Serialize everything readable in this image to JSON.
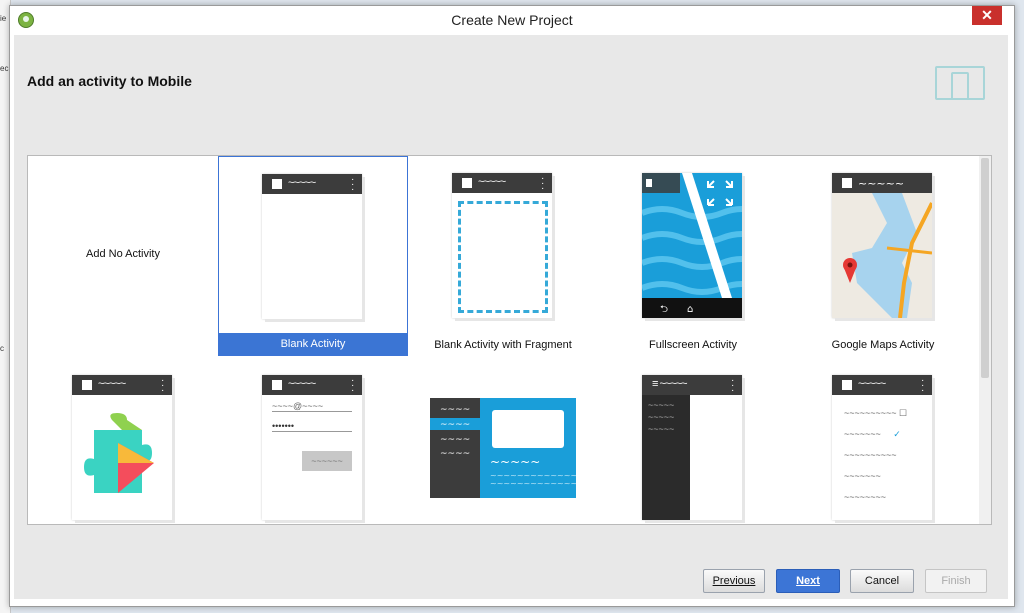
{
  "window": {
    "title": "Create New Project",
    "close_label": "✕"
  },
  "header": {
    "heading": "Add an activity to Mobile"
  },
  "gallery": {
    "items": [
      {
        "label": "Add No Activity"
      },
      {
        "label": "Blank Activity",
        "selected": true
      },
      {
        "label": "Blank Activity with Fragment"
      },
      {
        "label": "Fullscreen Activity"
      },
      {
        "label": "Google Maps Activity"
      }
    ],
    "row2_form": {
      "email_placeholder": "~~~~@~~~~",
      "password_placeholder": "•••••••",
      "button_label": "~~~~~~"
    }
  },
  "footer": {
    "previous": "Previous",
    "next": "Next",
    "cancel": "Cancel",
    "finish": "Finish"
  },
  "colors": {
    "accent": "#3b75d4",
    "phone_bar": "#3c3c3c",
    "fragment_dash": "#35a9d8",
    "fullscreen_water": "#1a9ed9"
  }
}
